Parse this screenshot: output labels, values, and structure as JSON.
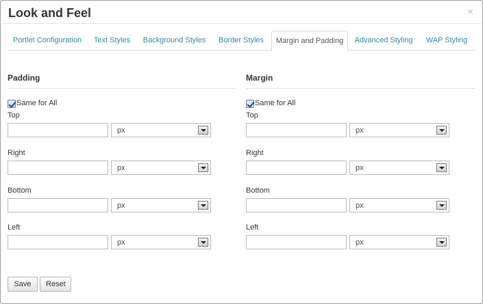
{
  "dialog": {
    "title": "Look and Feel",
    "close_glyph": "×"
  },
  "tabs": [
    {
      "label": "Portlet Configuration",
      "active": false
    },
    {
      "label": "Text Styles",
      "active": false
    },
    {
      "label": "Background Styles",
      "active": false
    },
    {
      "label": "Border Styles",
      "active": false
    },
    {
      "label": "Margin and Padding",
      "active": true
    },
    {
      "label": "Advanced Styling",
      "active": false
    },
    {
      "label": "WAP Styling",
      "active": false
    }
  ],
  "padding": {
    "heading": "Padding",
    "same_for_all_label": "Same for All",
    "same_for_all_checked": true,
    "fields": [
      {
        "label": "Top",
        "value": "",
        "unit": "px"
      },
      {
        "label": "Right",
        "value": "",
        "unit": "px"
      },
      {
        "label": "Bottom",
        "value": "",
        "unit": "px"
      },
      {
        "label": "Left",
        "value": "",
        "unit": "px"
      }
    ]
  },
  "margin": {
    "heading": "Margin",
    "same_for_all_label": "Same for All",
    "same_for_all_checked": true,
    "fields": [
      {
        "label": "Top",
        "value": "",
        "unit": "px"
      },
      {
        "label": "Right",
        "value": "",
        "unit": "px"
      },
      {
        "label": "Bottom",
        "value": "",
        "unit": "px"
      },
      {
        "label": "Left",
        "value": "",
        "unit": "px"
      }
    ]
  },
  "actions": {
    "save_label": "Save",
    "reset_label": "Reset"
  },
  "colors": {
    "tab_link": "#2a8aa8",
    "text": "#333333",
    "border": "#b8b8b8"
  }
}
